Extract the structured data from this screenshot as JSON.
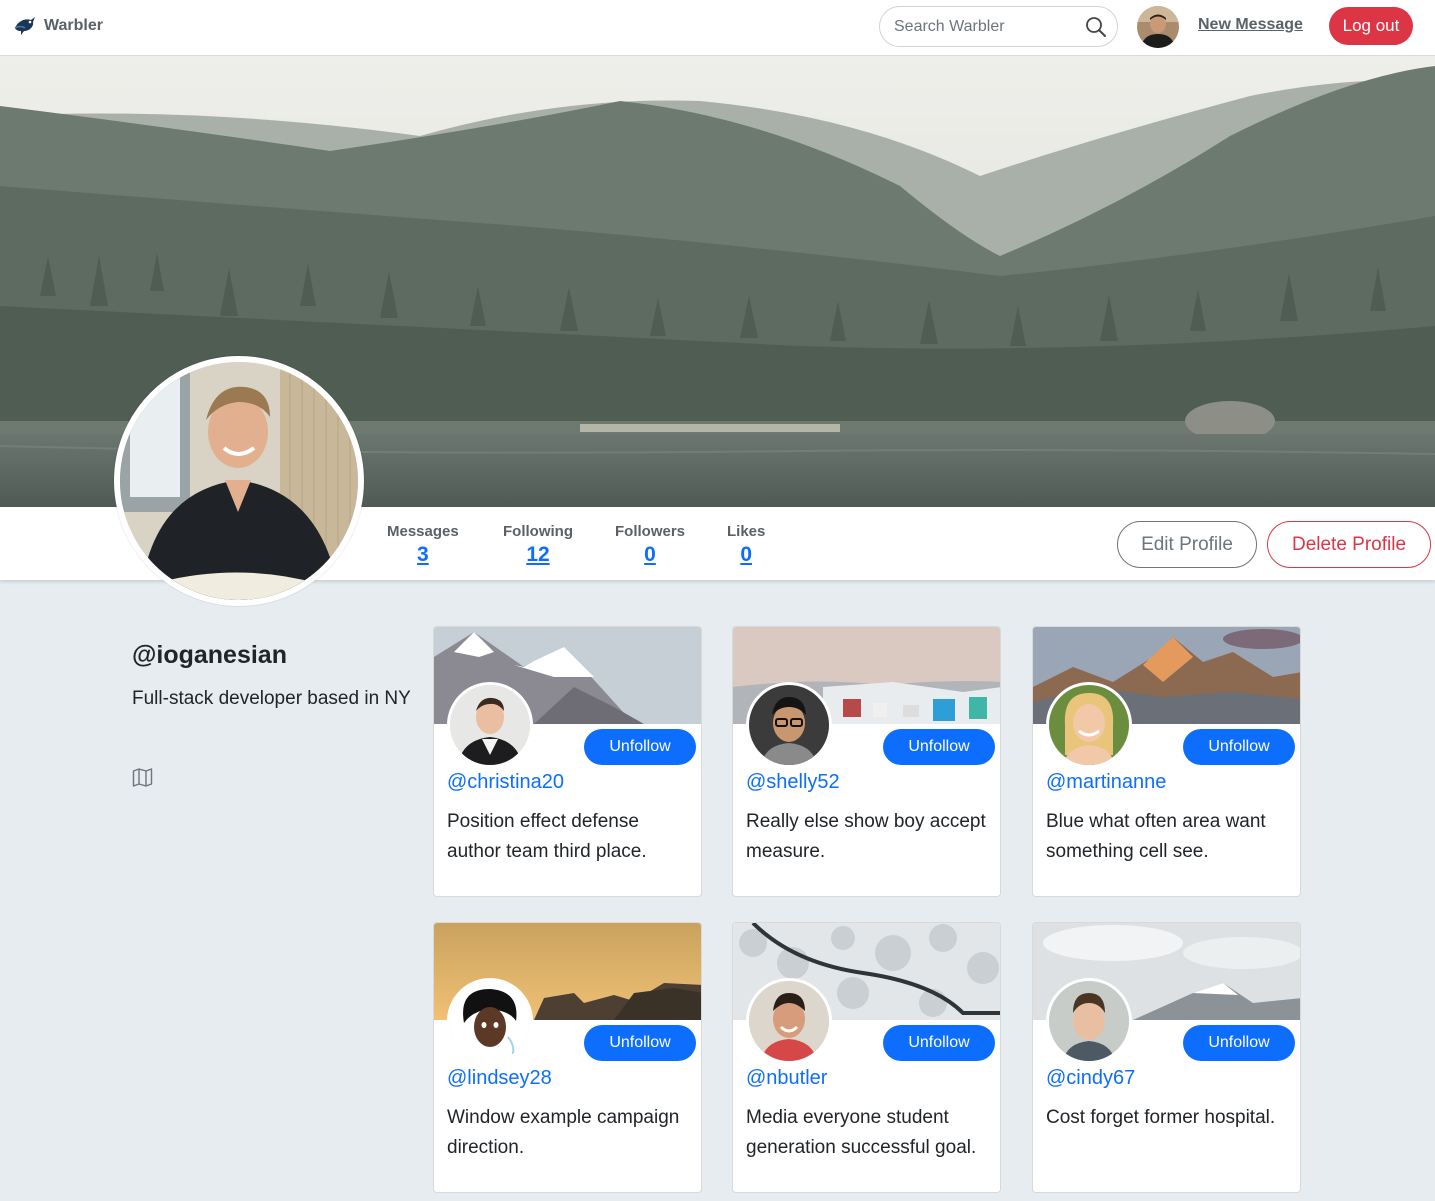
{
  "nav": {
    "brand": "Warbler",
    "search_placeholder": "Search Warbler",
    "new_message": "New Message",
    "logout": "Log out"
  },
  "profile": {
    "username": "@ioganesian",
    "bio": "Full-stack developer based in NY",
    "stats": [
      {
        "label": "Messages",
        "value": "3"
      },
      {
        "label": "Following",
        "value": "12"
      },
      {
        "label": "Followers",
        "value": "0"
      },
      {
        "label": "Likes",
        "value": "0"
      }
    ],
    "edit_label": "Edit Profile",
    "delete_label": "Delete Profile"
  },
  "following": [
    {
      "handle": "@christina20",
      "text": "Position effect defense author team third place.",
      "button": "Unfollow"
    },
    {
      "handle": "@shelly52",
      "text": "Really else show boy accept measure.",
      "button": "Unfollow"
    },
    {
      "handle": "@martinanne",
      "text": "Blue what often area want something cell see.",
      "button": "Unfollow"
    },
    {
      "handle": "@lindsey28",
      "text": "Window example campaign direction.",
      "button": "Unfollow"
    },
    {
      "handle": "@nbutler",
      "text": "Media everyone student generation successful goal.",
      "button": "Unfollow"
    },
    {
      "handle": "@cindy67",
      "text": "Cost forget former hospital.",
      "button": "Unfollow"
    }
  ],
  "colors": {
    "primary": "#0d6efd",
    "danger": "#dc3545",
    "background": "#e6ecf0"
  }
}
